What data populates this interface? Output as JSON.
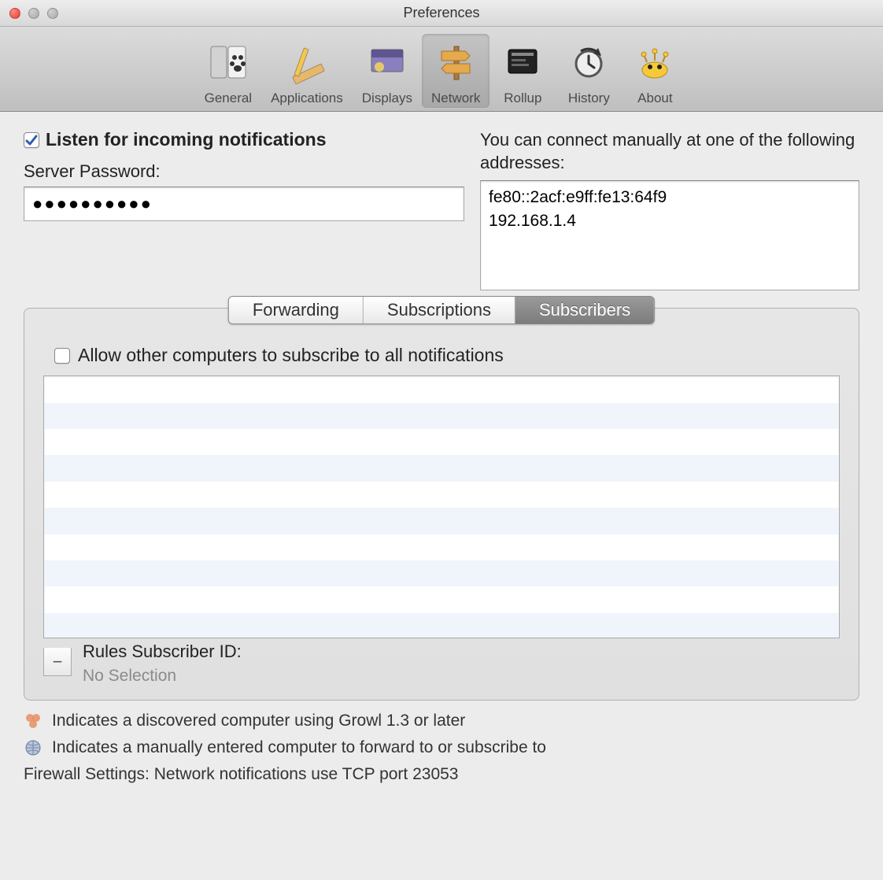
{
  "window": {
    "title": "Preferences"
  },
  "toolbar": {
    "items": [
      {
        "label": "General"
      },
      {
        "label": "Applications"
      },
      {
        "label": "Displays"
      },
      {
        "label": "Network"
      },
      {
        "label": "Rollup"
      },
      {
        "label": "History"
      },
      {
        "label": "About"
      }
    ],
    "selected": "Network"
  },
  "network": {
    "listen_label": "Listen for incoming notifications",
    "listen_checked": true,
    "password_label": "Server Password:",
    "password_value": "●●●●●●●●●●",
    "manual_label": "You can connect manually at one of the following addresses:",
    "addresses": [
      "fe80::2acf:e9ff:fe13:64f9",
      "192.168.1.4"
    ],
    "tabs": [
      {
        "label": "Forwarding"
      },
      {
        "label": "Subscriptions"
      },
      {
        "label": "Subscribers"
      }
    ],
    "selected_tab": "Subscribers",
    "allow_label": "Allow other computers to subscribe to all notifications",
    "allow_checked": false,
    "remove_button": "−",
    "rules_label": "Rules Subscriber ID:",
    "no_selection": "No Selection"
  },
  "legend": {
    "discovered": "Indicates a discovered computer using Growl 1.3 or later",
    "manual": "Indicates a manually entered computer to forward to or subscribe to",
    "firewall": "Firewall Settings: Network notifications use TCP port 23053"
  }
}
